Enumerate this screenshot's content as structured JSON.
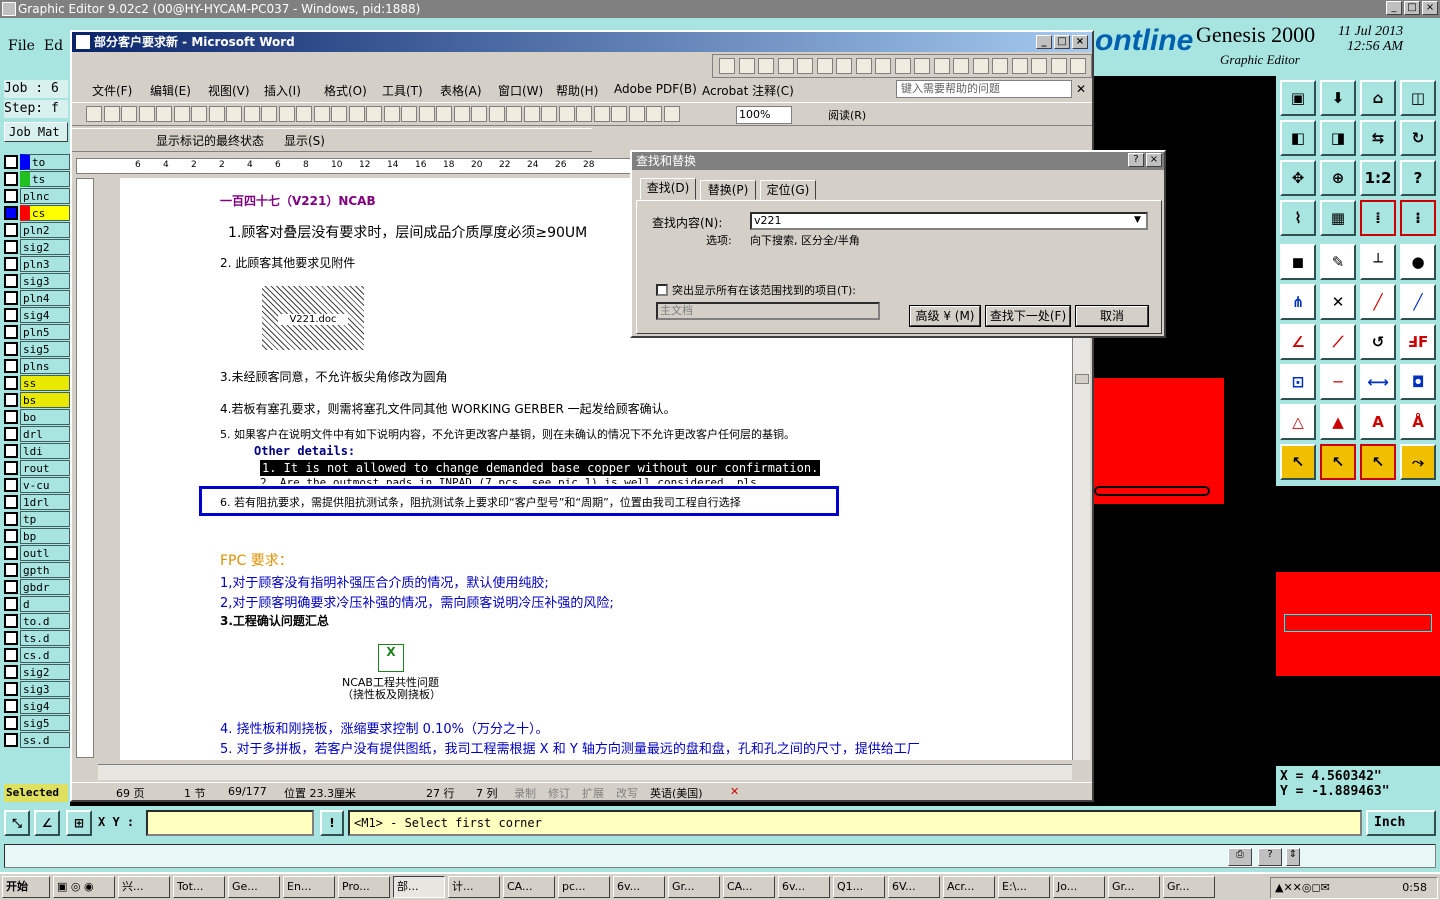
{
  "genesis": {
    "title_bar": "Graphic Editor 9.02c2 (00@HY-HYCAM-PC037 - Windows, pid:1888)",
    "menu_file": "File",
    "menu_edit": "Ed",
    "logo_text": "ontline",
    "product": "Genesis 2000",
    "subtitle": "Graphic Editor",
    "date": "11 Jul 2013",
    "time": "12:56 AM",
    "job_label": "Job : 6",
    "step_label": "Step: f",
    "job_matrix": "Job Mat",
    "layers": [
      "to",
      "ts",
      "plnc",
      "cs",
      "pln2",
      "sig2",
      "pln3",
      "sig3",
      "pln4",
      "sig4",
      "pln5",
      "sig5",
      "plns",
      "ss",
      "bs",
      "bo",
      "drl",
      "ldi",
      "rout",
      "v-cu",
      "1drl",
      "tp",
      "bp",
      "outl",
      "gpth",
      "gbdr",
      "d",
      "to.d",
      "ts.d",
      "cs.d",
      "sig2",
      "sig3",
      "sig4",
      "sig5",
      "ss.d"
    ],
    "selected_label": "Selected",
    "coord_x": "X = 4.560342\"",
    "coord_y": "Y = -1.889463\"",
    "xy_label": "X Y :",
    "command": "<M1> - Select first corner",
    "units": "Inch",
    "colors": {
      "panel": "#a8e4e0",
      "canvas": "#000000",
      "feature": "#ff0000"
    }
  },
  "word": {
    "title": "部分客户要求新 - Microsoft Word",
    "menus": [
      "文件(F)",
      "编辑(E)",
      "视图(V)",
      "插入(I)",
      "格式(O)",
      "工具(T)",
      "表格(A)",
      "窗口(W)",
      "帮助(H)",
      "Adobe PDF(B)",
      "Acrobat 注释(C)"
    ],
    "help_placeholder": "键入需要帮助的问题",
    "zoom": "100%",
    "read_label": "阅读(R)",
    "markup_view": "显示标记的最终状态",
    "show_label": "显示(S)",
    "ruler_marks": [
      "6",
      "4",
      "2",
      "2",
      "4",
      "6",
      "8",
      "10",
      "12",
      "14",
      "16",
      "18",
      "20",
      "22",
      "24",
      "26",
      "28"
    ],
    "doc_lines": {
      "heading": "一百四十七（V221）NCAB",
      "l1": "1.顾客对叠层没有要求时，层间成品介质厚度必须≥90UM",
      "l2": "2.  此顾客其他要求见附件",
      "attach1": "V221.doc",
      "l3": "3.未经顾客同意，不允许板尖角修改为圆角",
      "l4": "4.若板有塞孔要求，则需将塞孔文件同其他 WORKING GERBER 一起发给顾客确认。",
      "l5": "5.  如果客户在说明文件中有如下说明内容，不允许更改客户基铜，则在未确认的情况下不允许更改客户任何层的基铜。",
      "other_details": "Other details:",
      "eng1": "1. It is not allowed to change demanded base copper without our confirmation.",
      "eng2": "2. Are the outmost pads in INPAD (7 pcs, see pic 1) is well considered, pls",
      "l6": "6. 若有阻抗要求，需提供阻抗测试条，阻抗测试条上要求印“客户型号”和“周期”，位置由我司工程自行选择",
      "fpc": "FPC 要求：",
      "f1": "1,对于顾客没有指明补强压合介质的情况，默认使用纯胶;",
      "f2": "2,对于顾客明确要求冷压补强的情况，需向顾客说明冷压补强的风险;",
      "f3": "3.工程确认问题汇总",
      "attach2a": "NCAB工程共性问题",
      "attach2b": "（挠性板及刚挠板）",
      "l7": "4.  挠性板和刚挠板，涨缩要求控制 0.10%（万分之十）。",
      "l8": "5.  对于多拼板，若客户没有提供图纸，我司工程需根据 X 和 Y 轴方向测量最远的盘和盘，孔和孔之间的尺寸，提供给工厂"
    },
    "status": {
      "page": "69 页",
      "section": "1 节",
      "pages": "69/177",
      "pos": "位置 23.3厘米",
      "line": "27 行",
      "col": "7 列",
      "rec": "录制",
      "trk": "修订",
      "ext": "扩展",
      "ovr": "改写",
      "lang": "英语(美国)"
    }
  },
  "find_dialog": {
    "title": "查找和替换",
    "tabs": [
      "查找(D)",
      "替换(P)",
      "定位(G)"
    ],
    "find_label": "查找内容(N):",
    "find_value": "v221",
    "options_label": "选项:",
    "options_value": "向下搜索, 区分全/半角",
    "highlight_label": "突出显示所有在该范围找到的项目(T):",
    "scope_value": "主文档",
    "btn_more": "高级 ¥ (M)",
    "btn_find_next": "查找下一处(F)",
    "btn_cancel": "取消"
  },
  "taskbar": {
    "start": "开始",
    "tasks": [
      "兴...",
      "Tot...",
      "Ge...",
      "En...",
      "Pro...",
      "部...",
      "计...",
      "CA...",
      "pc...",
      "6v...",
      "Gr...",
      "CA...",
      "6v...",
      "Q1...",
      "6V...",
      "Acr...",
      "E:\\...",
      "Jo...",
      "Gr...",
      "Gr..."
    ],
    "clock": "0:58"
  }
}
